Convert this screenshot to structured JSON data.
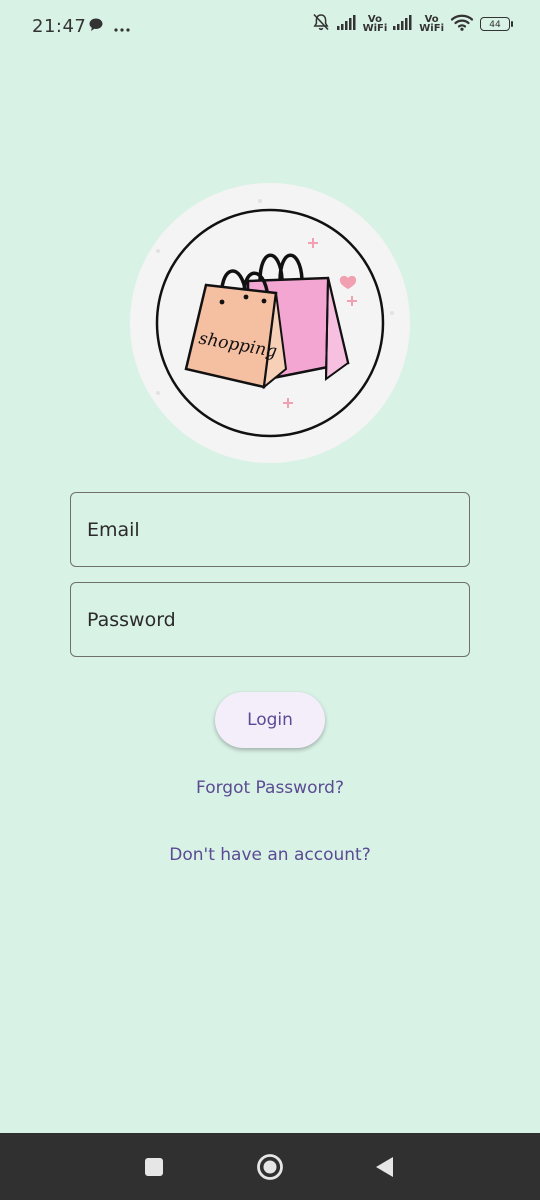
{
  "status_bar": {
    "time": "21:47",
    "vowifi_top": "Vo",
    "vowifi_bottom": "WiFi",
    "battery": "44",
    "icons": [
      "message-icon",
      "more-dots-icon",
      "mute-bell-icon",
      "signal-icon",
      "wifi-icon",
      "battery-icon"
    ]
  },
  "logo": {
    "bag_text": "shopping",
    "colors": {
      "bag_front": "#f5bfa2",
      "bag_back": "#f4a6d3",
      "accent": "#f0a0b0"
    }
  },
  "form": {
    "email_placeholder": "Email",
    "password_placeholder": "Password",
    "login_label": "Login",
    "forgot_label": "Forgot Password?",
    "signup_label": "Don't have an account?"
  },
  "nav_bar": {
    "icons": [
      "recent-apps-icon",
      "home-icon",
      "back-icon"
    ]
  },
  "colors": {
    "background": "#d9f2e6",
    "accent_text": "#5b4b93",
    "button_bg": "#f4eefb",
    "nav_bg": "#2f302f"
  }
}
